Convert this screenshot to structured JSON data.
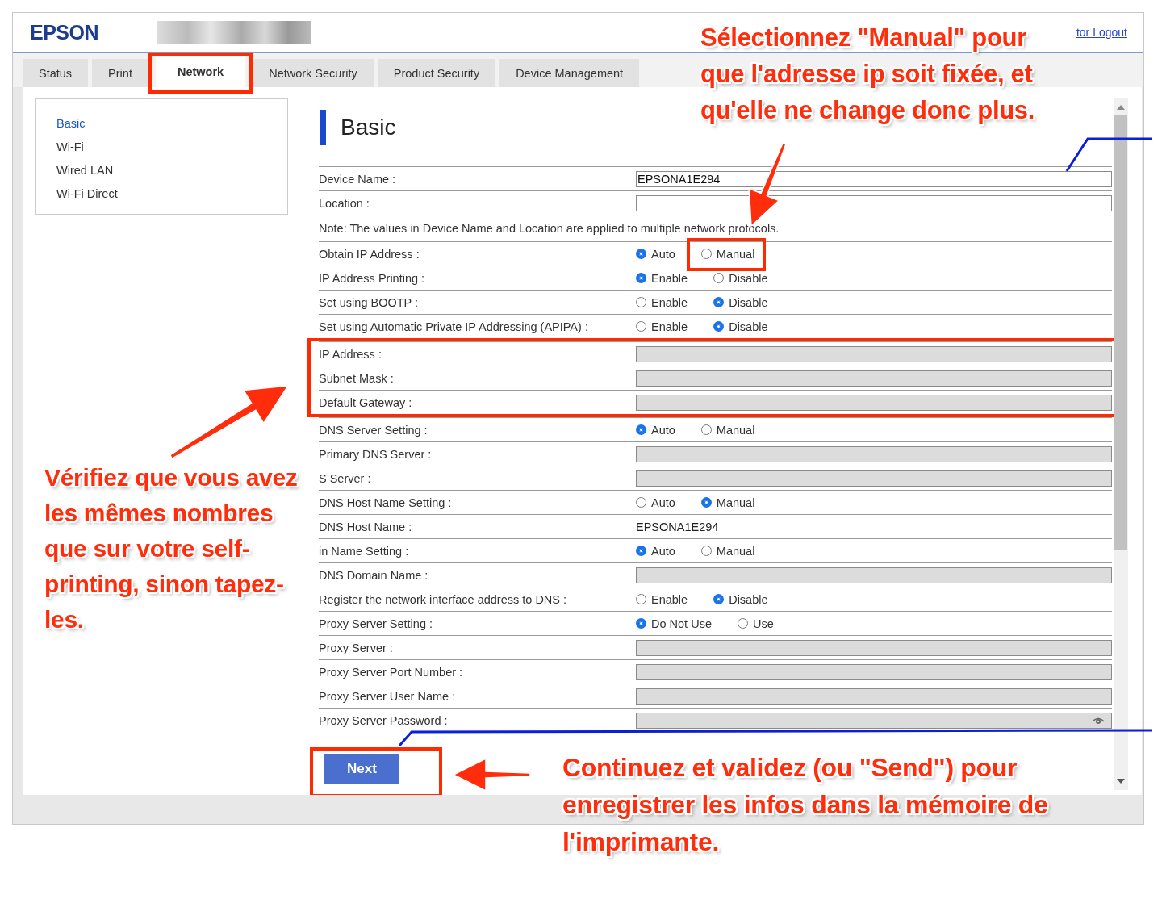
{
  "header": {
    "logo": "EPSON",
    "logout_link": "tor Logout"
  },
  "tabs": [
    {
      "label": "Status",
      "selected": false,
      "highlighted": false
    },
    {
      "label": "Print",
      "selected": false,
      "highlighted": false
    },
    {
      "label": "Network",
      "selected": true,
      "highlighted": true
    },
    {
      "label": "Network Security",
      "selected": false,
      "highlighted": false
    },
    {
      "label": "Product Security",
      "selected": false,
      "highlighted": false
    },
    {
      "label": "Device Management",
      "selected": false,
      "highlighted": false
    }
  ],
  "sidebar": {
    "items": [
      {
        "label": "Basic",
        "selected": true
      },
      {
        "label": "Wi-Fi",
        "selected": false
      },
      {
        "label": "Wired LAN",
        "selected": false
      },
      {
        "label": "Wi-Fi Direct",
        "selected": false
      }
    ]
  },
  "page_title": "Basic",
  "row_groups": [
    {
      "highlighted": false,
      "rows": [
        {
          "kind": "field",
          "label": "Device Name :",
          "value": "EPSONA1E294",
          "disabled": false
        },
        {
          "kind": "field",
          "label": "Location :",
          "disabled": false
        },
        {
          "kind": "note",
          "text": "Note: The values in Device Name and Location are applied to multiple network protocols."
        },
        {
          "kind": "radio",
          "label": "Obtain IP Address :",
          "options": [
            {
              "label": "Auto",
              "selected": true,
              "highlighted": false
            },
            {
              "label": "Manual",
              "selected": false,
              "highlighted": true
            }
          ]
        },
        {
          "kind": "radio",
          "label": "IP Address Printing :",
          "options": [
            {
              "label": "Enable",
              "selected": true,
              "highlighted": false
            },
            {
              "label": "Disable",
              "selected": false,
              "highlighted": false
            }
          ]
        },
        {
          "kind": "radio",
          "label": "Set using BOOTP :",
          "options": [
            {
              "label": "Enable",
              "selected": false,
              "highlighted": false
            },
            {
              "label": "Disable",
              "selected": true,
              "highlighted": false
            }
          ]
        },
        {
          "kind": "radio",
          "label": "Set using Automatic Private IP Addressing (APIPA) :",
          "options": [
            {
              "label": "Enable",
              "selected": false,
              "highlighted": false
            },
            {
              "label": "Disable",
              "selected": true,
              "highlighted": false
            }
          ]
        }
      ]
    },
    {
      "highlighted": true,
      "rows": [
        {
          "kind": "field",
          "label": "IP Address :",
          "disabled": true
        },
        {
          "kind": "field",
          "label": "Subnet Mask :",
          "disabled": true
        },
        {
          "kind": "field",
          "label": "Default Gateway :",
          "disabled": true
        }
      ]
    },
    {
      "highlighted": false,
      "rows": [
        {
          "kind": "radio",
          "label": "DNS Server Setting :",
          "options": [
            {
              "label": "Auto",
              "selected": true,
              "highlighted": false
            },
            {
              "label": "Manual",
              "selected": false,
              "highlighted": false
            }
          ]
        },
        {
          "kind": "field",
          "label": "Primary DNS Server :",
          "disabled": true
        },
        {
          "kind": "field",
          "label": "S Server :",
          "disabled": true
        },
        {
          "kind": "radio",
          "label": "DNS Host Name Setting :",
          "options": [
            {
              "label": "Auto",
              "selected": false,
              "highlighted": false
            },
            {
              "label": "Manual",
              "selected": true,
              "highlighted": false
            }
          ]
        },
        {
          "kind": "text",
          "label": "DNS Host Name :",
          "value": "EPSONA1E294"
        },
        {
          "kind": "radio",
          "label": "in Name Setting :",
          "options": [
            {
              "label": "Auto",
              "selected": true,
              "highlighted": false
            },
            {
              "label": "Manual",
              "selected": false,
              "highlighted": false
            }
          ]
        },
        {
          "kind": "field",
          "label": "DNS Domain Name :",
          "disabled": true
        },
        {
          "kind": "radio",
          "label": "Register the network interface address to DNS :",
          "options": [
            {
              "label": "Enable",
              "selected": false,
              "highlighted": false
            },
            {
              "label": "Disable",
              "selected": true,
              "highlighted": false
            }
          ]
        },
        {
          "kind": "radio",
          "label": "Proxy Server Setting :",
          "options": [
            {
              "label": "Do Not Use",
              "selected": true,
              "highlighted": false
            },
            {
              "label": "Use",
              "selected": false,
              "highlighted": false
            }
          ]
        },
        {
          "kind": "field",
          "label": "Proxy Server :",
          "disabled": true
        },
        {
          "kind": "field",
          "label": "Proxy Server Port Number :",
          "disabled": true
        },
        {
          "kind": "field",
          "label": "Proxy Server User Name :",
          "disabled": true
        },
        {
          "kind": "password",
          "label": "Proxy Server Password :",
          "disabled": true
        }
      ]
    }
  ],
  "next_button": {
    "label": "Next",
    "highlighted": true
  },
  "annotations": [
    {
      "kind": "top",
      "text": "Sélectionnez \"Manual\" pour que l'adresse ip soit fixée, et qu'elle ne change donc plus."
    },
    {
      "kind": "left",
      "text": "Vérifiez que vous avez les mêmes nombres que sur votre self-printing, sinon tapez-les."
    },
    {
      "kind": "bottom",
      "text": "Continuez et validez (ou \"Send\") pour enregistrer les infos dans la mémoire de l'imprimante."
    }
  ]
}
